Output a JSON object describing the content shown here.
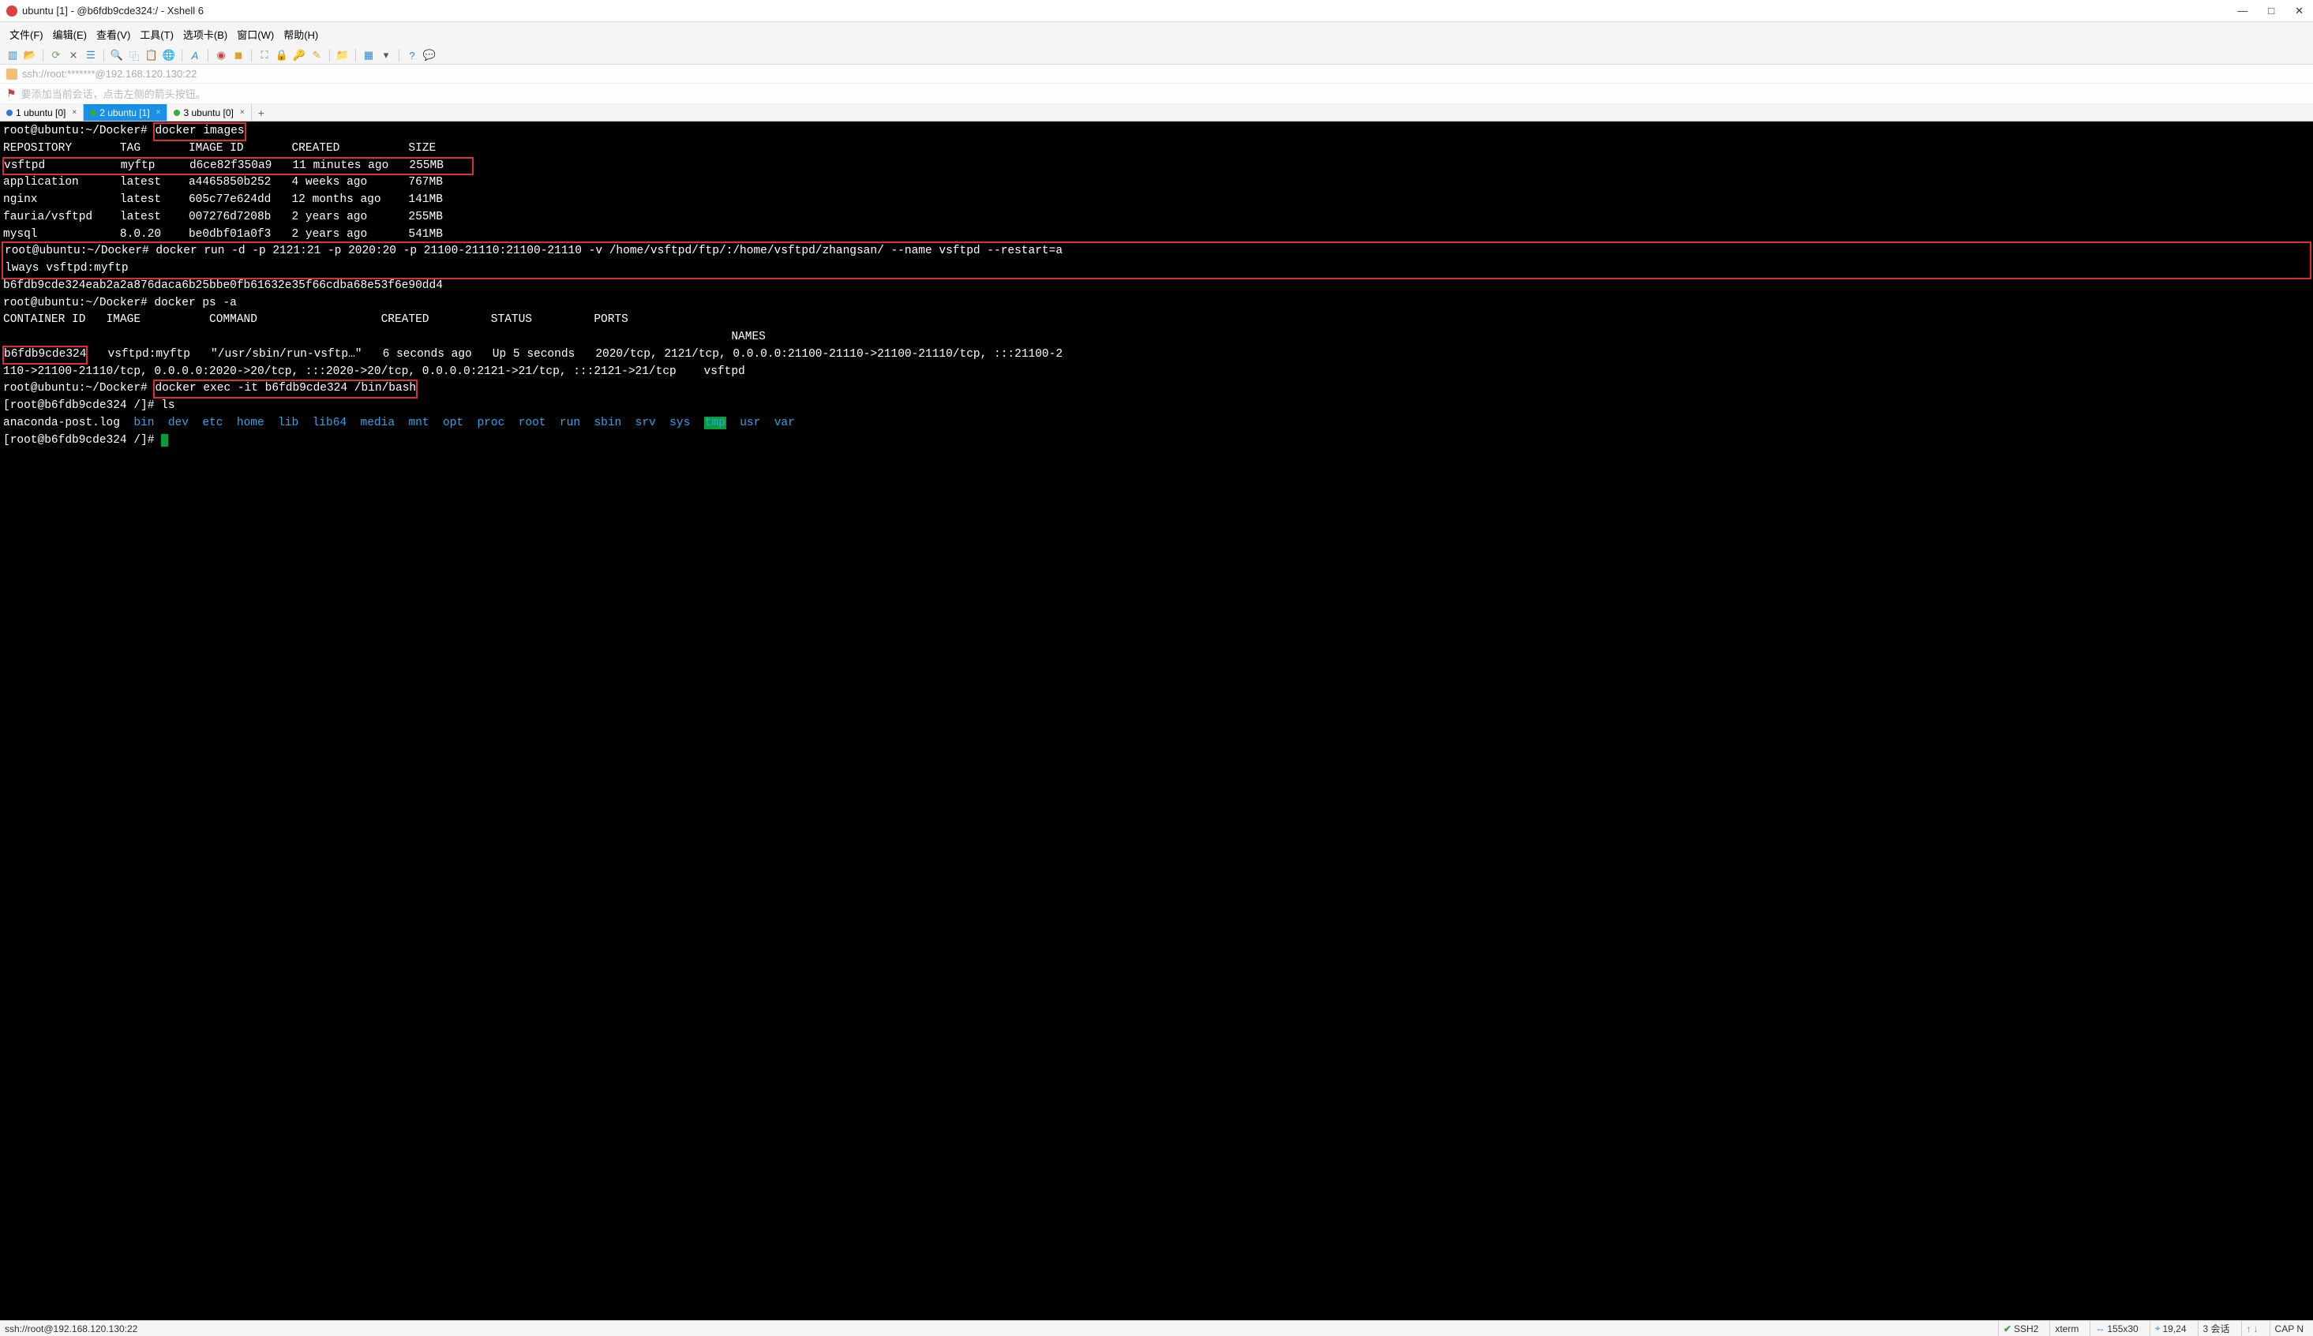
{
  "window": {
    "title": "ubuntu [1] - @b6fdb9cde324:/ - Xshell 6",
    "controls": {
      "minimize": "—",
      "maximize": "□",
      "close": "✕"
    }
  },
  "menu": {
    "file": "文件(F)",
    "edit": "编辑(E)",
    "view": "查看(V)",
    "tools": "工具(T)",
    "tabs": "选项卡(B)",
    "window": "窗口(W)",
    "help": "帮助(H)"
  },
  "addressbar": "ssh://root:*******@192.168.120.130:22",
  "hintbar": "要添加当前会话，点击左侧的箭头按钮。",
  "tabs": [
    {
      "label": "1 ubuntu [0]",
      "dot": "blue",
      "active": false
    },
    {
      "label": "2 ubuntu [1]",
      "dot": "green",
      "active": true
    },
    {
      "label": "3 ubuntu [0]",
      "dot": "green",
      "active": false
    }
  ],
  "terminal": {
    "prompt1": "root@ubuntu:~/Docker# ",
    "cmd_images": "docker images",
    "images_header": "REPOSITORY       TAG       IMAGE ID       CREATED          SIZE",
    "image_row1": "vsftpd           myftp     d6ce82f350a9   11 minutes ago   255MB",
    "image_rows_rest": "application      latest    a4465850b252   4 weeks ago      767MB\nnginx            latest    605c77e624dd   12 months ago    141MB\nfauria/vsftpd    latest    007276d7208b   2 years ago      255MB\nmysql            8.0.20    be0dbf01a0f3   2 years ago      541MB",
    "run_block_line1": "root@ubuntu:~/Docker# docker run -d -p 2121:21 -p 2020:20 -p 21100-21110:21100-21110 -v /home/vsftpd/ftp/:/home/vsftpd/zhangsan/ --name vsftpd --restart=a",
    "run_block_line2": "lways vsftpd:myftp",
    "run_hash": "b6fdb9cde324eab2a2a876daca6b25bbe0fb61632e35f66cdba68e53f6e90dd4",
    "prompt_ps": "root@ubuntu:~/Docker# docker ps -a",
    "ps_header": "CONTAINER ID   IMAGE          COMMAND                  CREATED         STATUS         PORTS",
    "ps_names_header": "                                                                                                          NAMES",
    "container_id": "b6fdb9cde324",
    "ps_row_rest": "   vsftpd:myftp   \"/usr/sbin/run-vsftp…\"   6 seconds ago   Up 5 seconds   2020/tcp, 2121/tcp, 0.0.0.0:21100-21110->21100-21110/tcp, :::21100-2",
    "ps_row2": "110->21100-21110/tcp, 0.0.0.0:2020->20/tcp, :::2020->20/tcp, 0.0.0.0:2121->21/tcp, :::2121->21/tcp    vsftpd",
    "prompt_exec_pre": "root@ubuntu:~/Docker# ",
    "cmd_exec": "docker exec -it b6fdb9cde324 /bin/bash",
    "prompt_inside": "[root@b6fdb9cde324 /]# ls",
    "ls_plain": "anaconda-post.log  ",
    "ls_dirs": [
      "bin",
      "dev",
      "etc",
      "home",
      "lib",
      "lib64",
      "media",
      "mnt",
      "opt",
      "proc",
      "root",
      "run",
      "sbin",
      "srv",
      "sys"
    ],
    "ls_tmp": "tmp",
    "ls_dirs_tail": [
      "usr",
      "var"
    ],
    "prompt_cursor": "[root@b6fdb9cde324 /]# "
  },
  "status": {
    "left": "ssh://root@192.168.120.130:22",
    "ssh2": "SSH2",
    "term": "xterm",
    "size": "155x30",
    "cursor": "19,24",
    "sessions": "3 会话",
    "cap": "CAP N"
  }
}
